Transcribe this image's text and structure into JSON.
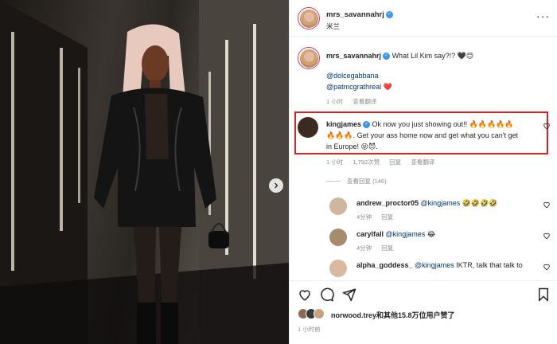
{
  "post": {
    "author": "mrs_savannahrj",
    "location": "米兰",
    "caption": "What Lil Kim say?!? 🖤😊",
    "mention1": "@dolcegabbana",
    "mention2": "@patmcgrathreal",
    "mention2_suffix": "❤️",
    "caption_time": "1 小时",
    "see_translation": "查看翻译"
  },
  "highlighted_comment": {
    "user": "kingjames",
    "line1": "Ok now you just showing out!! 🔥🔥🔥🔥🔥",
    "line2": "🔥🔥🔥. Get your ass home now and get what you can't get",
    "line3": "in Europe! 😝😈.",
    "time": "1 小时",
    "likes": "1,792次赞",
    "reply": "回复",
    "see_translation": "查看翻译"
  },
  "view_replies": "查看回复 (146)",
  "replies": [
    {
      "user": "andrew_proctor05",
      "mention": "@kingjames",
      "text": "🤣🤣🤣🤣",
      "time": "4分钟",
      "reply": "回复"
    },
    {
      "user": "carylfall",
      "mention": "@kingjames",
      "text": "😂",
      "time": "4分钟",
      "reply": "回复"
    },
    {
      "user": "alpha_goddess_",
      "mention": "@kingjames",
      "text": "IKTR, talk that talk to",
      "time": "",
      "reply": ""
    }
  ],
  "likes_text": "norwood.trey和其他15.8万位用户赞了",
  "post_time": "1 小时前",
  "icons": [
    "verified-badge",
    "heart-icon",
    "comment-icon",
    "share-icon",
    "bookmark-icon",
    "more-icon",
    "chevron-right-icon"
  ],
  "colors": {
    "accent": "#3897f0",
    "highlight_border": "#e02020",
    "link": "#00376b",
    "muted": "#8e8e8e"
  }
}
